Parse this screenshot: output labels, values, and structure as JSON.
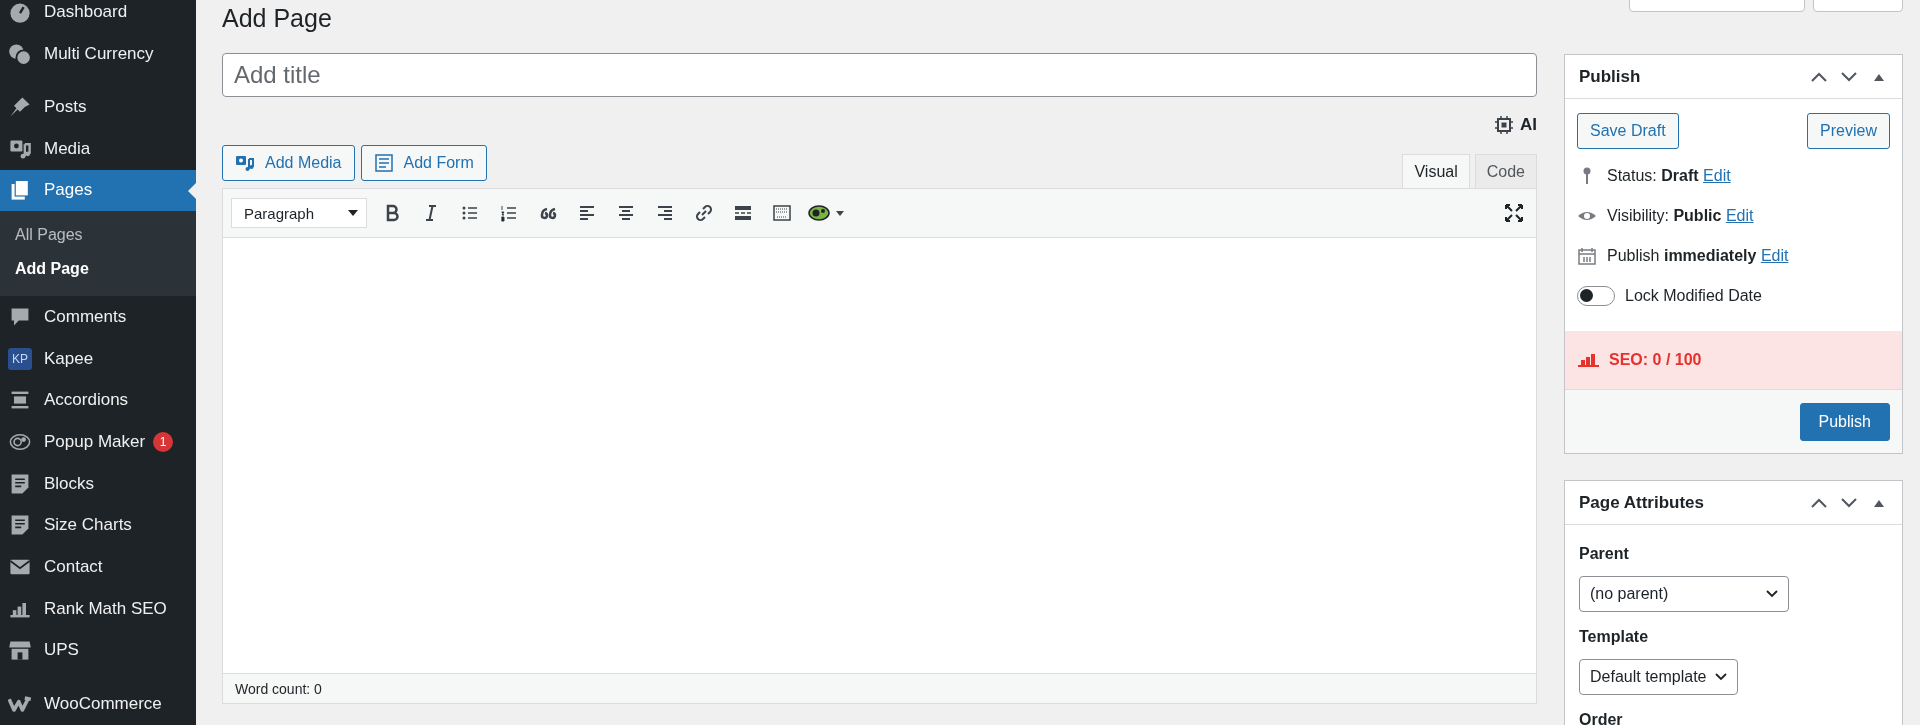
{
  "sidebar": {
    "items": [
      {
        "kind": "item",
        "label": "Dashboard",
        "selected": false
      },
      {
        "kind": "item",
        "label": "Multi Currency",
        "selected": false
      },
      {
        "kind": "separator"
      },
      {
        "kind": "item",
        "label": "Posts",
        "selected": false
      },
      {
        "kind": "item",
        "label": "Media",
        "selected": false
      },
      {
        "kind": "item",
        "label": "Pages",
        "selected": true,
        "children": [
          {
            "label": "All Pages",
            "selected": false
          },
          {
            "label": "Add Page",
            "selected": true
          }
        ]
      },
      {
        "kind": "item",
        "label": "Comments",
        "selected": false
      },
      {
        "kind": "item",
        "label": "Kapee",
        "selected": false,
        "icon_text": "KP"
      },
      {
        "kind": "item",
        "label": "Accordions",
        "selected": false
      },
      {
        "kind": "item",
        "label": "Popup Maker",
        "selected": false,
        "badge": "1"
      },
      {
        "kind": "item",
        "label": "Blocks",
        "selected": false
      },
      {
        "kind": "item",
        "label": "Size Charts",
        "selected": false
      },
      {
        "kind": "item",
        "label": "Contact",
        "selected": false
      },
      {
        "kind": "item",
        "label": "Rank Math SEO",
        "selected": false
      },
      {
        "kind": "item",
        "label": "UPS",
        "selected": false
      },
      {
        "kind": "separator"
      },
      {
        "kind": "item",
        "label": "WooCommerce",
        "selected": false
      }
    ]
  },
  "heading": "Add Page",
  "title_field": {
    "placeholder": "Add title"
  },
  "ai_button": "AI",
  "media_buttons": [
    "Add Media",
    "Add Form"
  ],
  "editor_tabs": [
    {
      "label": "Visual",
      "selected": true
    },
    {
      "label": "Code",
      "selected": false
    }
  ],
  "format_select": "Paragraph",
  "word_count": "Word count: 0",
  "publish_box": {
    "title": "Publish",
    "save_draft": "Save Draft",
    "preview": "Preview",
    "rows": [
      {
        "label": "Status:",
        "value": "Draft",
        "link": "Edit"
      },
      {
        "label": "Visibility:",
        "value": "Public",
        "link": "Edit"
      },
      {
        "label": "Publish",
        "value": "immediately",
        "link": "Edit"
      }
    ],
    "toggle": {
      "label": "Lock Modified Date",
      "on": false
    },
    "seo": "SEO: 0 / 100",
    "publish_button": "Publish"
  },
  "attributes_box": {
    "title": "Page Attributes",
    "parent_label": "Parent",
    "parent_value": "(no parent)",
    "template_label": "Template",
    "template_value": "Default template",
    "order_label": "Order"
  }
}
